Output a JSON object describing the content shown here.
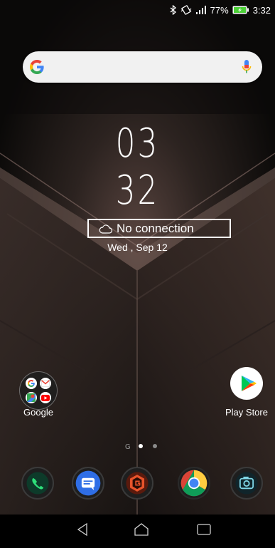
{
  "status_bar": {
    "battery_percent": "77%",
    "time": "3:32",
    "icons": [
      "bluetooth-icon",
      "vibrate-icon",
      "signal-icon",
      "battery-charging-icon"
    ]
  },
  "search_bar": {
    "logo_icon": "google-g-icon",
    "mic_icon": "mic-icon"
  },
  "clock_widget": {
    "hours": "03",
    "minutes": "32",
    "weather_text": "No connection",
    "date_text": "Wed , Sep 12"
  },
  "home_apps": [
    {
      "label": "Google",
      "type": "folder"
    },
    {
      "label": "Play Store",
      "type": "app"
    }
  ],
  "page_indicator": {
    "google_label": "G",
    "pages": 2,
    "active_page": 1
  },
  "dock": [
    "phone-icon",
    "messages-icon",
    "game-center-icon",
    "chrome-icon",
    "camera-icon"
  ],
  "navigation": [
    "back-icon",
    "home-icon",
    "recents-icon"
  ],
  "colors": {
    "google_blue": "#4285F4",
    "google_red": "#EA4335",
    "google_yellow": "#FBBC05",
    "google_green": "#34A853",
    "battery_green": "#4cd137",
    "rog_orange": "#e8542b"
  }
}
